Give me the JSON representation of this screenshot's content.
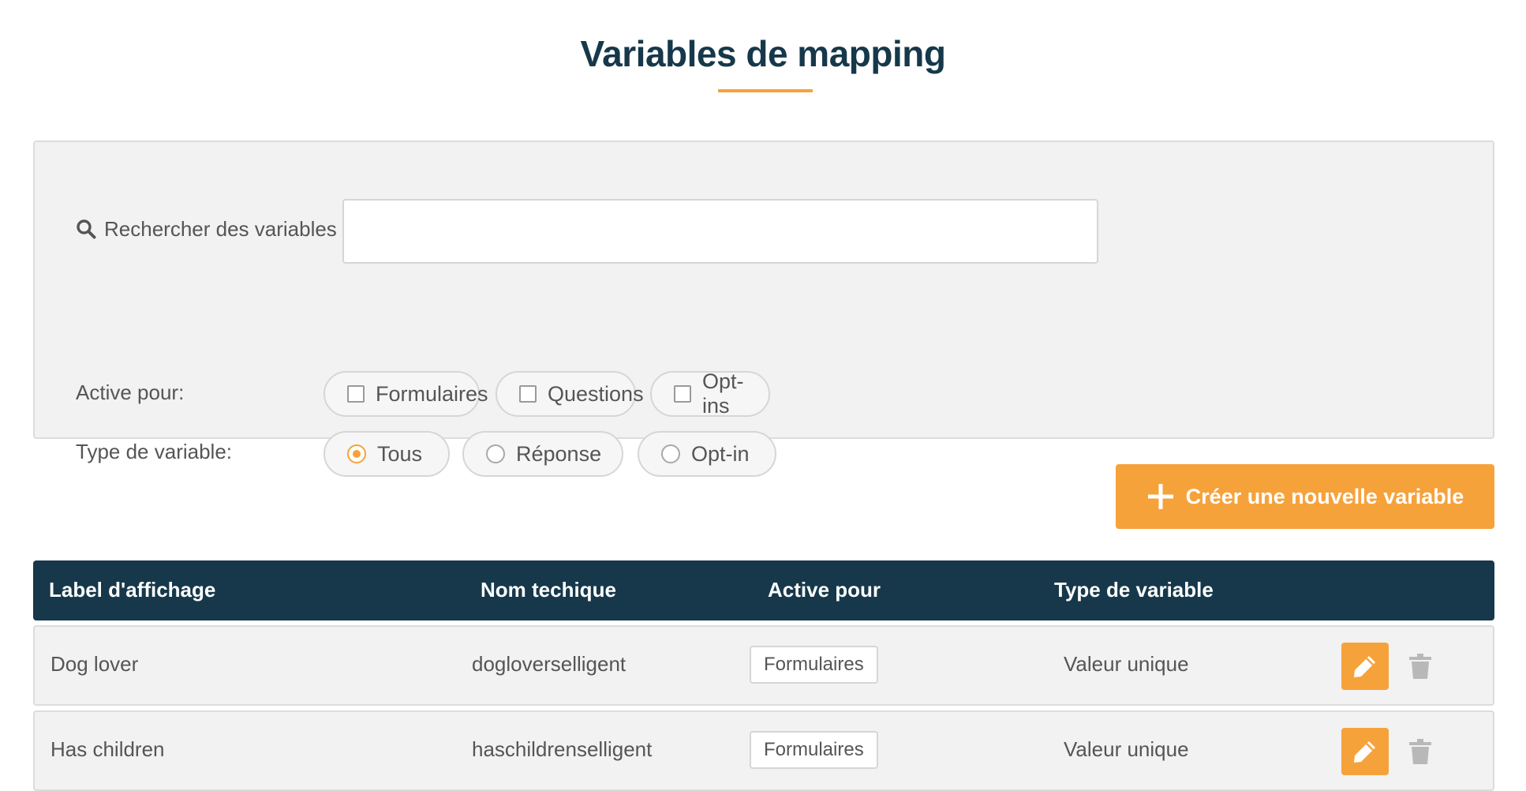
{
  "page": {
    "title": "Variables de mapping"
  },
  "filters": {
    "search_label": "Rechercher des variables",
    "search_value": "",
    "active_for_label": "Active pour:",
    "active_for_options": [
      {
        "label": "Formulaires",
        "checked": false
      },
      {
        "label": "Questions",
        "checked": false
      },
      {
        "label": "Opt-ins",
        "checked": false
      }
    ],
    "type_label": "Type de variable:",
    "type_options": [
      {
        "label": "Tous",
        "selected": true
      },
      {
        "label": "Réponse",
        "selected": false
      },
      {
        "label": "Opt-in",
        "selected": false
      }
    ]
  },
  "actions": {
    "create_label": "Créer une nouvelle variable"
  },
  "table": {
    "columns": [
      "Label d'affichage",
      "Nom techique",
      "Active pour",
      "Type de variable"
    ],
    "rows": [
      {
        "label": "Dog lover",
        "technical_name": "dogloverselligent",
        "active_for": "Formulaires",
        "type": "Valeur unique"
      },
      {
        "label": "Has children",
        "technical_name": "haschildrenselligent",
        "active_for": "Formulaires",
        "type": "Valeur unique"
      }
    ]
  },
  "colors": {
    "accent": "#f6a23a",
    "header_bg": "#16384a",
    "panel_bg": "#f2f2f2"
  },
  "icons": {
    "search": "search-icon",
    "plus": "plus-icon",
    "edit": "pencil-icon",
    "delete": "trash-icon"
  }
}
